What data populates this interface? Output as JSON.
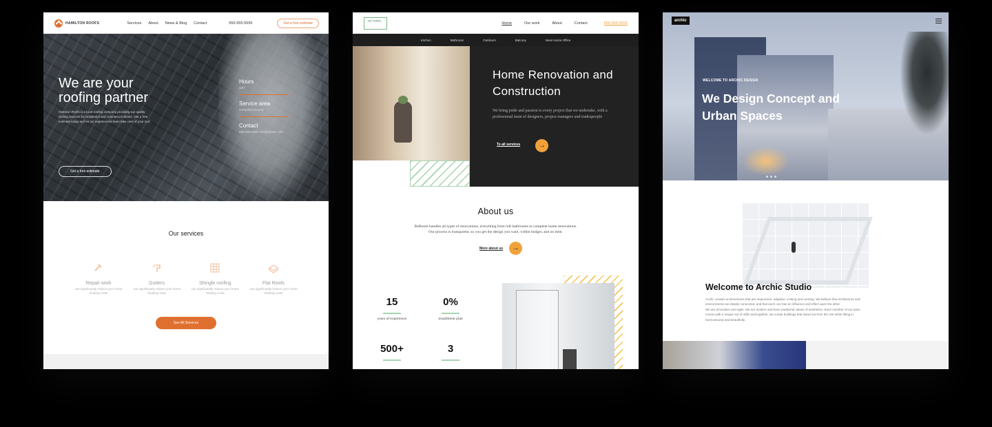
{
  "card1": {
    "brand": "HAMILTON ROOFS",
    "nav": [
      "Services",
      "About",
      "News & Blog",
      "Contact"
    ],
    "phone": "555-555-5555",
    "nav_cta": "Get a free estimate",
    "hero_title": "We are your roofing partner",
    "hero_text": "Hamilton Roofs is a local roofing company providing top quality roofing services for residential and commercial clients. Get a free estimate today and let our experienced team take care of your roof.",
    "hero_cta": "Get a free estimate",
    "info": [
      {
        "label": "Hours",
        "value": "24/7"
      },
      {
        "label": "Service area",
        "value": "Greenfield County"
      },
      {
        "label": "Contact",
        "value": "555-555-5555 info@mysite.com"
      }
    ],
    "services_title": "Our services",
    "services": [
      {
        "name": "Repair work",
        "desc": "can significantly reduce your home heating costs",
        "icon": "hammer-icon"
      },
      {
        "name": "Gutters",
        "desc": "can significantly reduce your home heating costs",
        "icon": "drill-icon"
      },
      {
        "name": "Shingle roofing",
        "desc": "can significantly reduce your home heating costs",
        "icon": "shingle-grid-icon"
      },
      {
        "name": "Flat Roofs",
        "desc": "can significantly reduce your home heating costs",
        "icon": "flat-roof-icon"
      }
    ],
    "all_services": "See All Services",
    "accent": "#e0702f"
  },
  "card2": {
    "logo": "re/ room.",
    "nav": [
      "Home",
      "Our work",
      "About",
      "Contact"
    ],
    "phone": "555-555-5555",
    "subnav": [
      "Kitchen",
      "Bathroom",
      "Outdoors",
      "Balcony",
      "New! Home Office"
    ],
    "hero_title": "Home Renovation and Construction",
    "hero_text": "We bring pride and passion to every project that we undertake, with a professional team of designers, project managers and tradespeople",
    "hero_link": "To all services",
    "about_title": "About us",
    "about_text": "ReRoom handles all types of renovations, everything from loft bathrooms to complete home renovations. Our process is transparent, so you get the design you want, within budget, and on time.",
    "about_link": "More about us",
    "stats": [
      {
        "num": "15",
        "label": "years of experience"
      },
      {
        "num": "0%",
        "label": "installment plan"
      },
      {
        "num": "500+",
        "label": ""
      },
      {
        "num": "3",
        "label": ""
      }
    ],
    "accent": "#f0a13a",
    "green": "#a7d3b1"
  },
  "card3": {
    "logo": "archic",
    "kicker": "WELCOME TO ARCHIC DESIGN",
    "hero_title": "We Design Concept and Urban Spaces",
    "welcome_title": "Welcome to Archic Studio",
    "body1": "Archic creates environments that are responsive, adaptive, inviting and exciting. We believe that architecture and environments are deeply connected, and that each one has an influence and effect upon the other.",
    "body2": "We are innovative and agile. We are modern and have traditional values of aesthetics. Each member of our team comes with a unique set of skills and together, we create buildings that stand out from the rest while fitting in harmoniously and beautifully."
  }
}
